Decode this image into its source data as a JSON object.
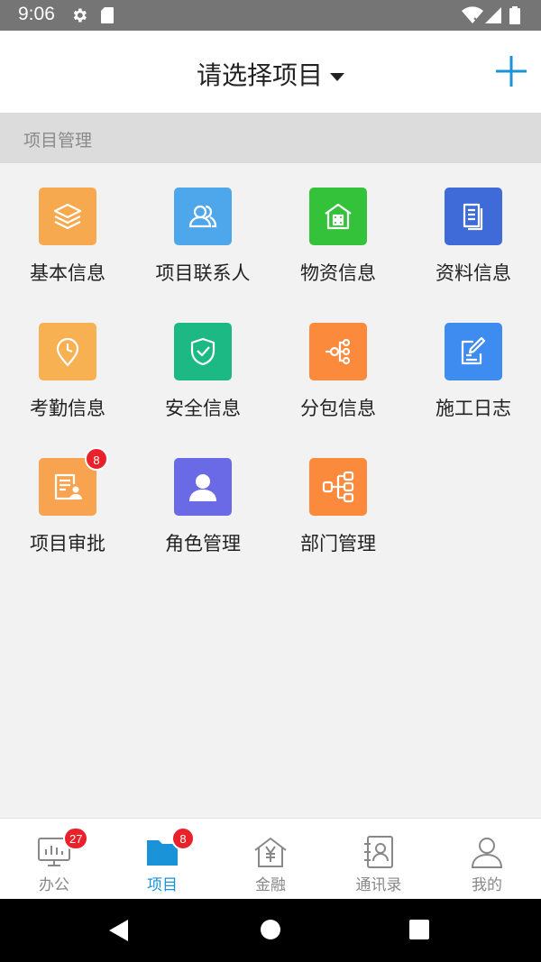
{
  "status_bar": {
    "time": "9:06",
    "icons": [
      "settings-gear-icon",
      "sd-card-icon",
      "wifi-icon",
      "cell-signal-icon",
      "battery-icon"
    ]
  },
  "header": {
    "title": "请选择项目",
    "add_icon": "plus-icon",
    "accent_color": "#1a93d9"
  },
  "section": {
    "title": "项目管理"
  },
  "grid_items": [
    {
      "label": "基本信息",
      "icon": "layers-icon",
      "color": "#f7a94f"
    },
    {
      "label": "项目联系人",
      "icon": "contacts-icon",
      "color": "#4fa7eb"
    },
    {
      "label": "物资信息",
      "icon": "warehouse-icon",
      "color": "#35c23b"
    },
    {
      "label": "资料信息",
      "icon": "documents-icon",
      "color": "#3f6bd9"
    },
    {
      "label": "考勤信息",
      "icon": "attendance-clock-icon",
      "color": "#f7b052"
    },
    {
      "label": "安全信息",
      "icon": "shield-check-icon",
      "color": "#1db985"
    },
    {
      "label": "分包信息",
      "icon": "subcontract-tree-icon",
      "color": "#fb8a3c"
    },
    {
      "label": "施工日志",
      "icon": "log-edit-icon",
      "color": "#3f8cf0"
    },
    {
      "label": "项目审批",
      "icon": "approval-icon",
      "color": "#f8a34f",
      "badge": "8"
    },
    {
      "label": "角色管理",
      "icon": "user-role-icon",
      "color": "#6a6ae6"
    },
    {
      "label": "部门管理",
      "icon": "org-chart-icon",
      "color": "#fb8a3c"
    }
  ],
  "bottom_nav": [
    {
      "label": "办公",
      "icon": "office-monitor-icon",
      "badge": "27",
      "active": false
    },
    {
      "label": "项目",
      "icon": "folder-icon",
      "badge": "8",
      "active": true
    },
    {
      "label": "金融",
      "icon": "finance-house-icon",
      "active": false
    },
    {
      "label": "通讯录",
      "icon": "address-book-icon",
      "active": false
    },
    {
      "label": "我的",
      "icon": "profile-icon",
      "active": false
    }
  ],
  "system_nav": [
    "back-icon",
    "home-icon",
    "recents-icon"
  ]
}
